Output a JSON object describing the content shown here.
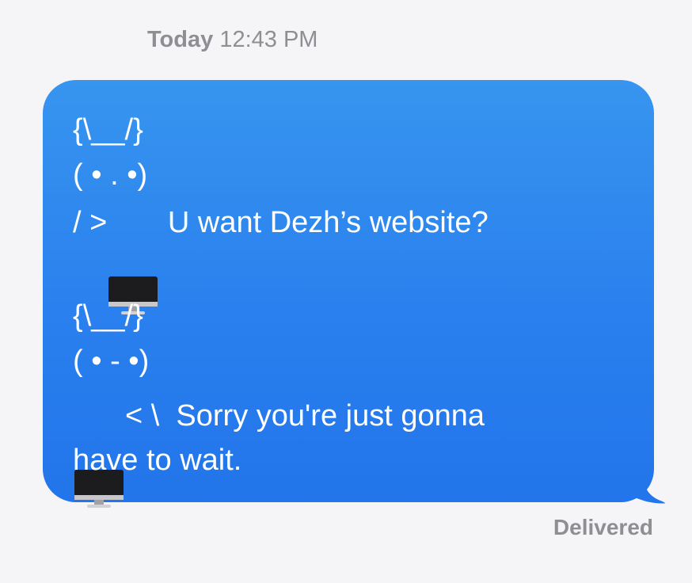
{
  "header": {
    "day": "Today",
    "time": "12:43 PM"
  },
  "message": {
    "line1": "{\\__/}",
    "line2": "( • . •)",
    "line3_prefix": "/ >",
    "line3_suffix": " U want Dezh’s website?",
    "line4": "{\\__/}",
    "line5": "( • - •)",
    "line6_suffix": "< \\  Sorry you're just gonna",
    "line7": "have to wait."
  },
  "icons": {
    "computer": "desktop-computer-icon"
  },
  "status": {
    "delivered": "Delivered"
  },
  "colors": {
    "bubble_top": "#3795ef",
    "bubble_bottom": "#2275ea",
    "background": "#f5f5f7",
    "meta_text": "#8e8e93"
  }
}
